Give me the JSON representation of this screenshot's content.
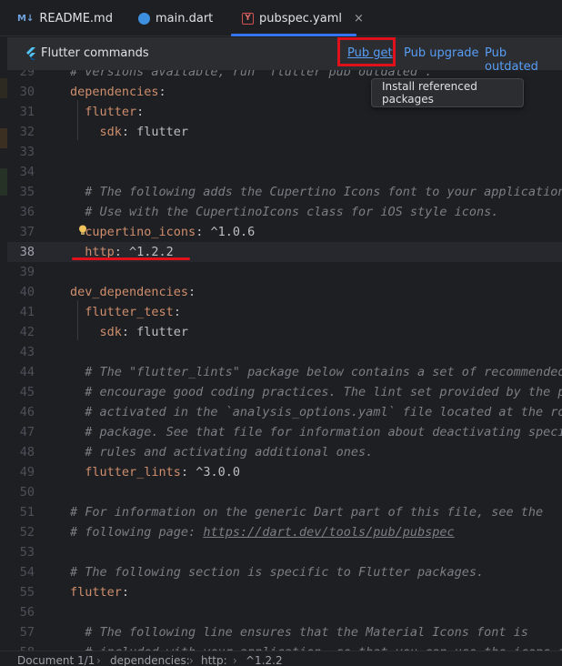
{
  "tabs": {
    "readme": {
      "icon": "M↓",
      "label": "README.md"
    },
    "main": {
      "label": "main.dart"
    },
    "pubspec": {
      "icon": "Y",
      "label": "pubspec.yaml",
      "close": "×"
    }
  },
  "banner": {
    "title": "Flutter commands",
    "pub_get": "Pub get",
    "pub_upgrade": "Pub upgrade",
    "pub_outdated": "Pub outdated"
  },
  "tooltip": "Install referenced packages",
  "editor": {
    "current_line": "38",
    "lines": [
      {
        "n": "29",
        "partial": "# versions available, run `flutter pub outdated`."
      },
      {
        "n": "30",
        "key": "dependencies",
        "rest": ":"
      },
      {
        "n": "31",
        "indent": "  ",
        "key": "flutter",
        "rest": ":"
      },
      {
        "n": "32",
        "indent": "    ",
        "key": "sdk",
        "rest": ": flutter"
      },
      {
        "n": "33"
      },
      {
        "n": "34"
      },
      {
        "n": "35",
        "comment": "  # The following adds the Cupertino Icons font to your application."
      },
      {
        "n": "36",
        "comment": "  # Use with the CupertinoIcons class for iOS style icons."
      },
      {
        "n": "37",
        "indent": "  ",
        "key": "cupertino_icons",
        "rest": ": ^1.0.6"
      },
      {
        "n": "38",
        "indent": "  ",
        "key": "http",
        "rest": ": ^1.2.2"
      },
      {
        "n": "39"
      },
      {
        "n": "40",
        "key": "dev_dependencies",
        "rest": ":"
      },
      {
        "n": "41",
        "indent": "  ",
        "key": "flutter_test",
        "rest": ":"
      },
      {
        "n": "42",
        "indent": "    ",
        "key": "sdk",
        "rest": ": flutter"
      },
      {
        "n": "43"
      },
      {
        "n": "44",
        "comment": "  # The \"flutter_lints\" package below contains a set of recommended"
      },
      {
        "n": "45",
        "comment": "  # encourage good coding practices. The lint set provided by the pa"
      },
      {
        "n": "46",
        "comment": "  # activated in the `analysis_options.yaml` file located at the roo"
      },
      {
        "n": "47",
        "comment": "  # package. See that file for information about deactivating specif"
      },
      {
        "n": "48",
        "comment": "  # rules and activating additional ones."
      },
      {
        "n": "49",
        "indent": "  ",
        "key": "flutter_lints",
        "rest": ": ^3.0.0"
      },
      {
        "n": "50"
      },
      {
        "n": "51",
        "comment": "# For information on the generic Dart part of this file, see the"
      },
      {
        "n": "52",
        "comment": "# following page: ",
        "url": "https://dart.dev/tools/pub/pubspec"
      },
      {
        "n": "53"
      },
      {
        "n": "54",
        "comment": "# The following section is specific to Flutter packages."
      },
      {
        "n": "55",
        "key": "flutter",
        "rest": ":"
      },
      {
        "n": "56"
      },
      {
        "n": "57",
        "comment": "  # The following line ensures that the Material Icons font is"
      },
      {
        "n": "58",
        "comment": "  # included with your application, so that you can use the icons in"
      }
    ]
  },
  "statusbar": {
    "crumbs": [
      "Document 1/1",
      "dependencies:",
      "http:",
      "^1.2.2"
    ],
    "separator": "›"
  },
  "colors": {
    "accent": "#3574f0",
    "link": "#589df6",
    "highlight": "#e0111b",
    "yaml_key": "#cf8e6d",
    "comment": "#7a7e85"
  }
}
